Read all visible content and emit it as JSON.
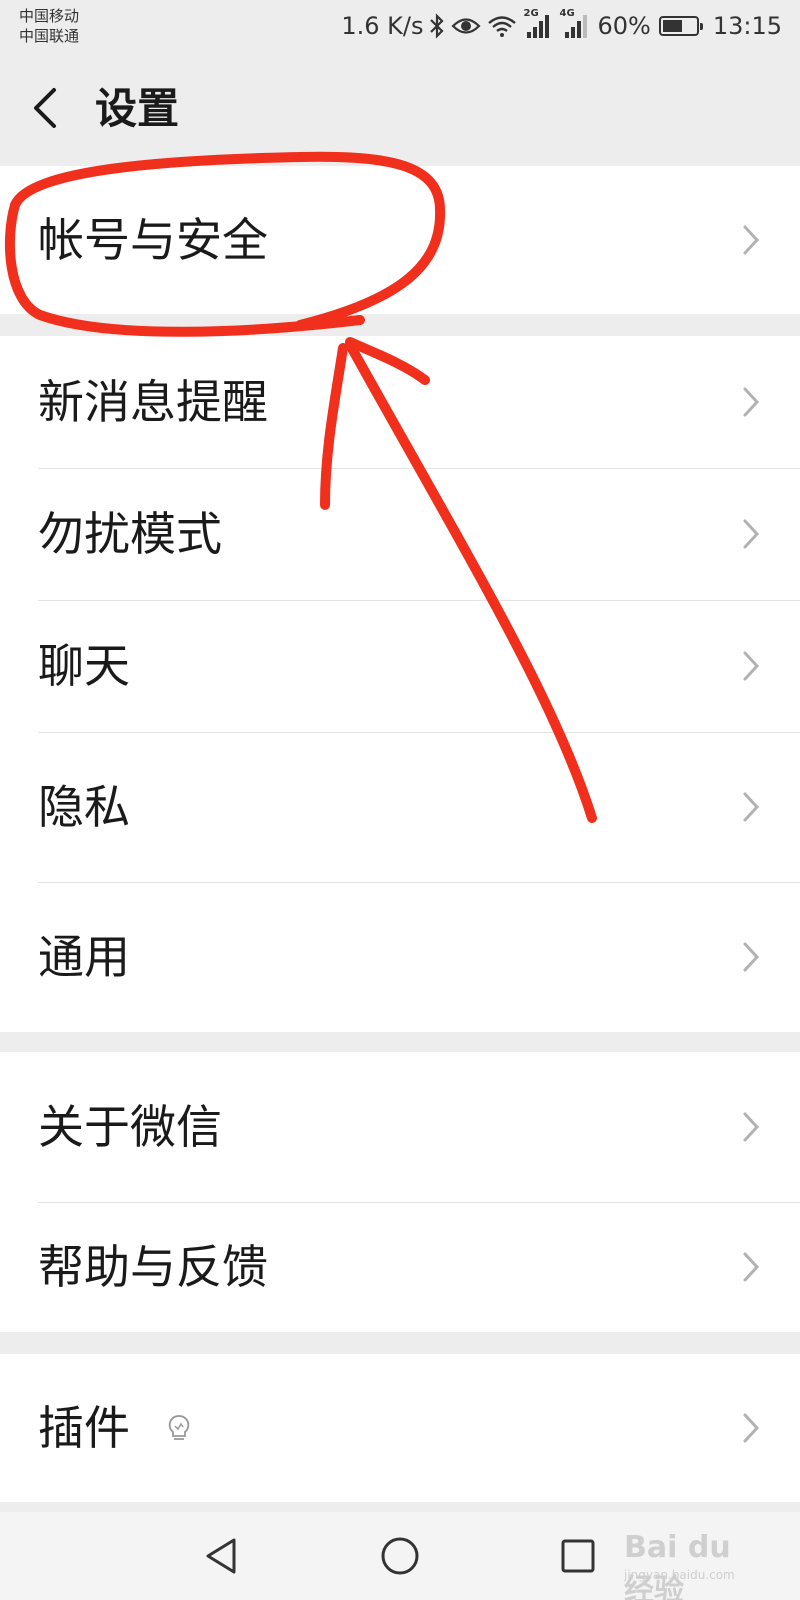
{
  "status_bar": {
    "carrier_1": "中国移动",
    "carrier_2": "中国联通",
    "net_speed": "1.6 K/s",
    "network_2g": "2G",
    "network_4g": "4G",
    "battery_percent": "60%",
    "battery_level": 0.6,
    "time": "13:15"
  },
  "nav": {
    "title": "设置"
  },
  "groups": [
    {
      "items": [
        {
          "label": "帐号与安全"
        }
      ]
    },
    {
      "items": [
        {
          "label": "新消息提醒"
        },
        {
          "label": "勿扰模式"
        },
        {
          "label": "聊天"
        },
        {
          "label": "隐私"
        },
        {
          "label": "通用"
        }
      ]
    },
    {
      "items": [
        {
          "label": "关于微信"
        },
        {
          "label": "帮助与反馈"
        }
      ]
    },
    {
      "items": [
        {
          "label": "插件"
        }
      ]
    }
  ],
  "watermark": {
    "brand": "Bai du 经验",
    "url": "jingyan.baidu.com"
  },
  "colors": {
    "annotation_red": "#f0301c",
    "background": "#ededed",
    "item_background": "#ffffff"
  }
}
